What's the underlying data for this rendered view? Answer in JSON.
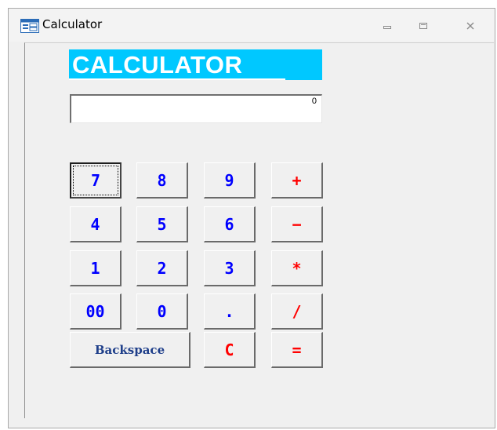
{
  "window": {
    "title": "Calculator",
    "controls": {
      "minimize_icon": "minimize-icon",
      "restore_icon": "restore-icon",
      "close_icon": "close-icon"
    }
  },
  "form": {
    "heading": "CALCULATOR",
    "display_value": "0"
  },
  "keypad": {
    "row1": [
      "7",
      "8",
      "9",
      "+"
    ],
    "row2": [
      "4",
      "5",
      "6",
      "−"
    ],
    "row3": [
      "1",
      "2",
      "3",
      "*"
    ],
    "row4": [
      "00",
      "0",
      ".",
      "/"
    ],
    "row5": [
      "Backspace",
      "C",
      "="
    ]
  },
  "colors": {
    "heading_background": "#00c8ff",
    "digit_text": "#0000ff",
    "operator_text": "#ff0000",
    "backspace_text": "#1f3f8a"
  }
}
